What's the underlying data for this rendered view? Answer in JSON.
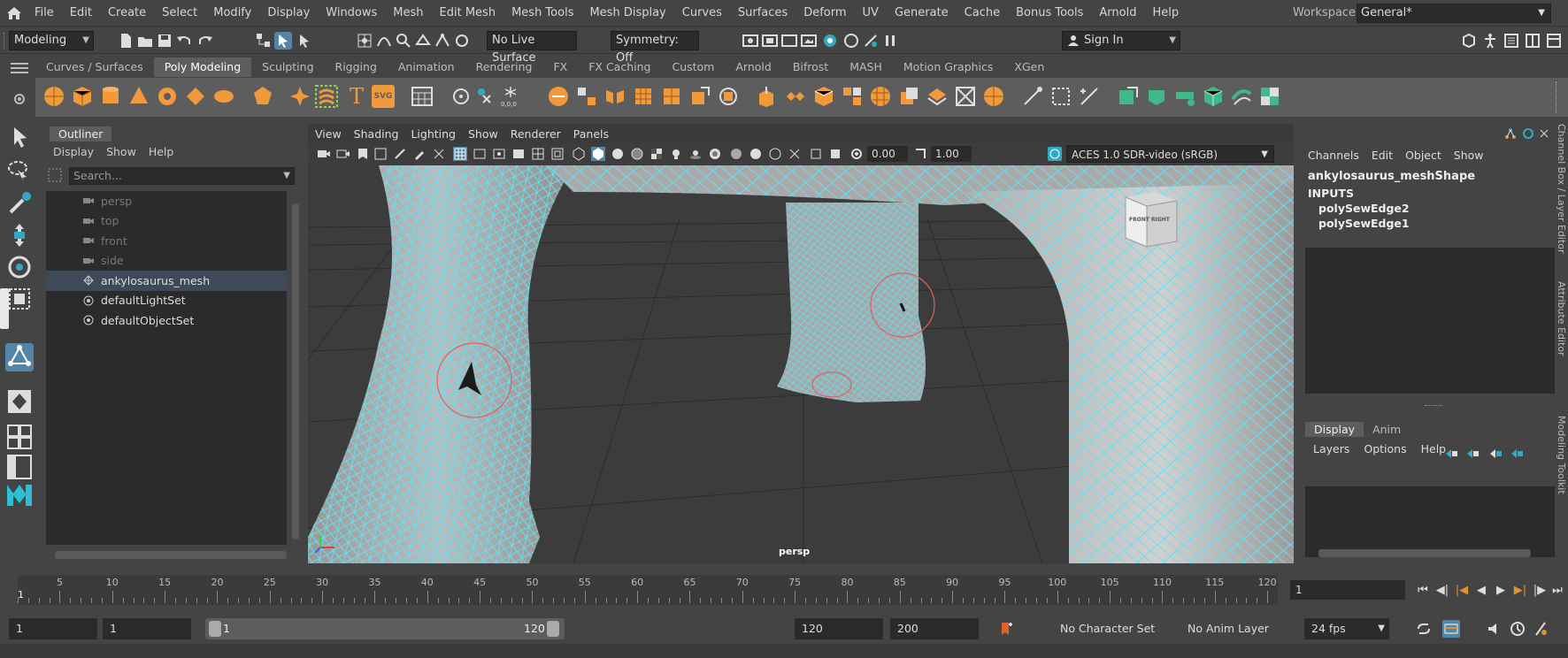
{
  "menubar": {
    "items": [
      "File",
      "Edit",
      "Create",
      "Select",
      "Modify",
      "Display",
      "Windows",
      "Mesh",
      "Edit Mesh",
      "Mesh Tools",
      "Mesh Display",
      "Curves",
      "Surfaces",
      "Deform",
      "UV",
      "Generate",
      "Cache",
      "Bonus Tools",
      "Arnold",
      "Help"
    ],
    "workspace_label": "Workspace:",
    "workspace_value": "General*"
  },
  "statusline": {
    "mode": "Modeling",
    "live_surface": "No Live Surface",
    "symmetry": "Symmetry: Off",
    "sign_in": "Sign In"
  },
  "shelf": {
    "tabs": [
      "Curves / Surfaces",
      "Poly Modeling",
      "Sculpting",
      "Rigging",
      "Animation",
      "Rendering",
      "FX",
      "FX Caching",
      "Custom",
      "Arnold",
      "Bifrost",
      "MASH",
      "Motion Graphics",
      "XGen"
    ],
    "active_tab": "Poly Modeling",
    "text_icons": {
      "type": "T",
      "svg": "SVG"
    }
  },
  "outliner": {
    "title": "Outliner",
    "menu": [
      "Display",
      "Show",
      "Help"
    ],
    "search_placeholder": "Search...",
    "items": [
      {
        "label": "persp",
        "icon": "camera-icon",
        "dim": true
      },
      {
        "label": "top",
        "icon": "camera-icon",
        "dim": true
      },
      {
        "label": "front",
        "icon": "camera-icon",
        "dim": true
      },
      {
        "label": "side",
        "icon": "camera-icon",
        "dim": true
      },
      {
        "label": "ankylosaurus_mesh",
        "icon": "mesh-icon",
        "selected": true
      },
      {
        "label": "defaultLightSet",
        "icon": "set-icon"
      },
      {
        "label": "defaultObjectSet",
        "icon": "set-icon"
      }
    ]
  },
  "viewport": {
    "menu": [
      "View",
      "Shading",
      "Lighting",
      "Show",
      "Renderer",
      "Panels"
    ],
    "exposure": "0.00",
    "gamma": "1.00",
    "color_space": "ACES 1.0 SDR-video (sRGB)",
    "camera": "persp",
    "viewcube_front": "FRONT",
    "viewcube_right": "RIGHT",
    "wire_color": "#5fe3f5"
  },
  "channelbox": {
    "menu": [
      "Channels",
      "Edit",
      "Object",
      "Show"
    ],
    "shape": "ankylosaurus_meshShape",
    "inputs_label": "INPUTS",
    "inputs": [
      "polySewEdge2",
      "polySewEdge1"
    ],
    "layer_tabs": [
      "Display",
      "Anim"
    ],
    "layer_menu": [
      "Layers",
      "Options",
      "Help"
    ],
    "side_tabs": [
      "Channel Box / Layer Editor",
      "Attribute Editor",
      "Modeling Toolkit"
    ]
  },
  "timeslider": {
    "ticks": [
      5,
      10,
      15,
      20,
      25,
      30,
      35,
      40,
      45,
      50,
      55,
      60,
      65,
      70,
      75,
      80,
      85,
      90,
      95,
      100,
      105,
      110,
      115,
      120
    ],
    "current_frame": "1",
    "current_frame_field": "1"
  },
  "rangeslider": {
    "start": "1",
    "playback_start": "1",
    "range_start_label": "1",
    "range_end_label": "120",
    "playback_end": "120",
    "end": "200",
    "character_set": "No Character Set",
    "anim_layer": "No Anim Layer",
    "fps": "24 fps"
  }
}
